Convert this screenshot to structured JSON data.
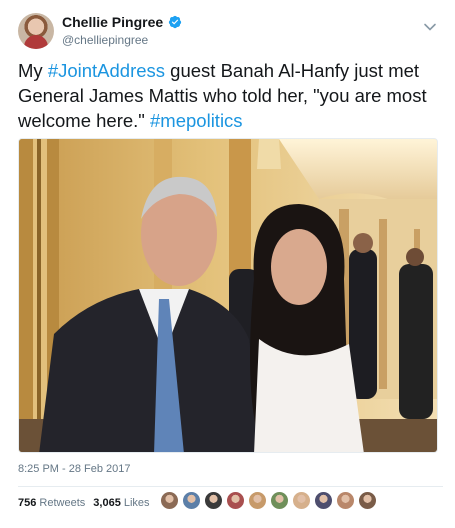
{
  "author": {
    "display_name": "Chellie Pingree",
    "handle": "@chelliepingree",
    "verified_icon": "verified-badge-icon"
  },
  "tweet": {
    "text_parts": [
      {
        "t": "My ",
        "type": "text"
      },
      {
        "t": "#JointAddress",
        "type": "hashtag"
      },
      {
        "t": " guest Banah Al-Hanfy just met General James Mattis who told her, \"you are most welcome here.\" ",
        "type": "text"
      },
      {
        "t": "#mepolitics",
        "type": "hashtag"
      }
    ],
    "timestamp": "8:25 PM - 28 Feb 2017"
  },
  "stats": {
    "retweets_count": "756",
    "retweets_label": "Retweets",
    "likes_count": "3,065",
    "likes_label": "Likes"
  },
  "likers": [
    {
      "color": "#8b6a55"
    },
    {
      "color": "#5c7fa8"
    },
    {
      "color": "#3a3a3a"
    },
    {
      "color": "#a94f4f"
    },
    {
      "color": "#c79a6a"
    },
    {
      "color": "#6f8f5a"
    },
    {
      "color": "#d6b08c"
    },
    {
      "color": "#4e4e6e"
    },
    {
      "color": "#b9876a"
    },
    {
      "color": "#7a5c48"
    }
  ],
  "colors": {
    "accent": "#1b95e0",
    "text": "#14171a",
    "muted": "#657786"
  }
}
